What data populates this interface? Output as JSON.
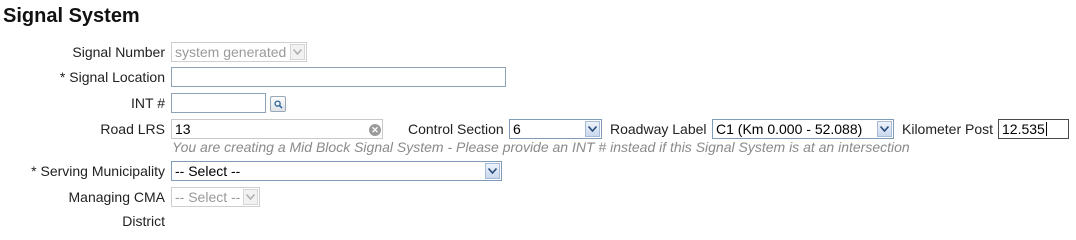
{
  "form": {
    "title": "Signal System",
    "signal_number": {
      "label": "Signal Number",
      "value": "system generated"
    },
    "signal_location": {
      "label": "* Signal Location",
      "value": ""
    },
    "int_number": {
      "label": "INT #",
      "value": ""
    },
    "road_lrs": {
      "label": "Road LRS",
      "value": "13"
    },
    "control_section": {
      "label": "Control Section",
      "value": "6"
    },
    "roadway_label": {
      "label": "Roadway Label",
      "value": "C1 (Km 0.000 - 52.088)"
    },
    "kilometer_post": {
      "label": "Kilometer Post",
      "value": "12.535"
    },
    "hint": "You are creating a Mid Block Signal System - Please provide an INT # instead if this Signal System is at an intersection",
    "serving_municipality": {
      "label": "* Serving Municipality",
      "value": "-- Select --"
    },
    "managing_cma": {
      "label": "Managing CMA",
      "value": "-- Select --"
    },
    "district": {
      "label": "District",
      "value": ""
    }
  },
  "icons": {
    "dropdown": "chevron-down-icon",
    "search": "magnifier-icon",
    "clear": "clear-circle-icon"
  }
}
